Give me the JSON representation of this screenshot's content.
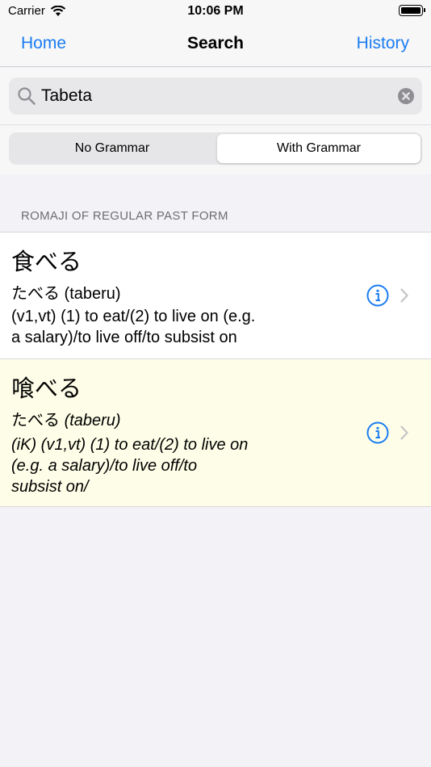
{
  "status_bar": {
    "carrier": "Carrier",
    "time": "10:06 PM"
  },
  "nav": {
    "left": "Home",
    "title": "Search",
    "right": "History"
  },
  "search": {
    "value": "Tabeta"
  },
  "segments": [
    {
      "label": "No Grammar"
    },
    {
      "label": "With Grammar"
    }
  ],
  "section": {
    "header": "ROMAJI OF REGULAR PAST FORM"
  },
  "results": [
    {
      "kanji": "食べる",
      "reading": "たべる (taberu)",
      "gloss_1": "(v1,vt) (1) to eat/(2) to live on (e.g.",
      "gloss_2": "a salary)/to live off/to subsist on"
    },
    {
      "kanji": "喰べる",
      "reading_kana": "たべる",
      "reading_romaji": "(taberu)",
      "gloss_1": "(iK) (v1,vt) (1) to eat/(2) to live on",
      "gloss_2": "(e.g. a salary)/to live off/to",
      "gloss_3": "subsist on/"
    }
  ],
  "colors": {
    "accent": "#1a7cf2",
    "highlight_row": "#fefee8"
  }
}
